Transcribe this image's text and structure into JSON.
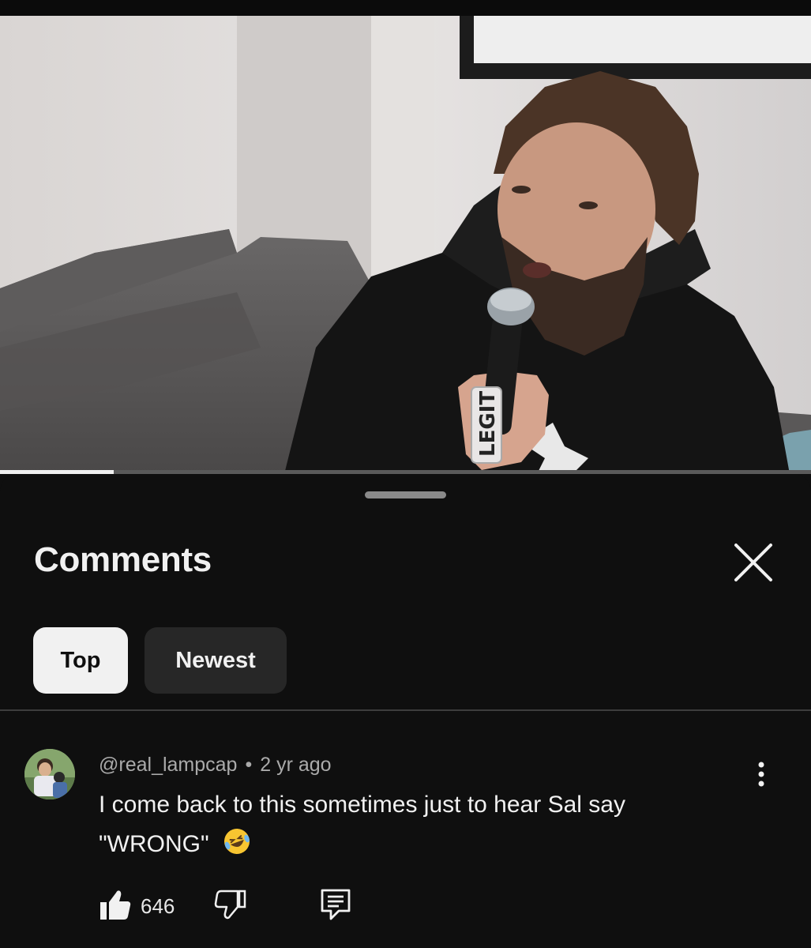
{
  "video": {
    "ring_text": "LEGIT",
    "progress_fraction": 0.14
  },
  "comments_sheet": {
    "title": "Comments",
    "filters": [
      "Top",
      "Newest"
    ],
    "selected_filter": "Top"
  },
  "comment": {
    "author": "@real_lampcap",
    "separator": "•",
    "time": "2 yr ago",
    "text_line1": "I come back to this sometimes just to hear Sal say",
    "text_line2": "\"WRONG\"",
    "emoji": "rolling-on-floor-laughing",
    "likes": "646"
  },
  "icons": {
    "close": "close-icon",
    "more": "more-vert-icon",
    "like": "thumb-up-icon",
    "dislike": "thumb-down-icon",
    "reply": "reply-icon"
  }
}
